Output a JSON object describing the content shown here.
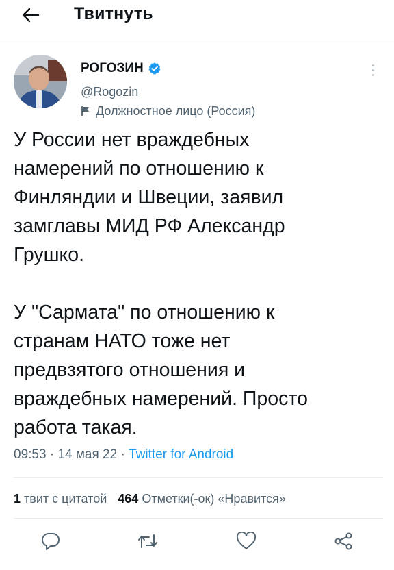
{
  "header": {
    "title": "Твитнуть"
  },
  "author": {
    "name": "РОГОЗИН",
    "handle": "@Rogozin",
    "label": "Должностное лицо (Россия)"
  },
  "tweet": {
    "text": "У России нет враждебных\nнамерений по отношению к\nФинляндии и Швеции, заявил\nзамглавы МИД РФ Александр\nГрушко.\n\nУ \"Сармата\" по отношению к\nстранам НАТО тоже нет\nпредвзятого отношения и\nвраждебных намерений. Просто\nработа такая.",
    "time": "09:53",
    "date": "14 мая 22",
    "sep": "·",
    "source": "Twitter for Android"
  },
  "stats": {
    "quotes_count": "1",
    "quotes_label": "твит с цитатой",
    "likes_count": "464",
    "likes_label": "Отметки(-ок) «Нравится»"
  },
  "colors": {
    "accent": "#1d9bf0",
    "muted": "#536471",
    "text": "#0f1419"
  },
  "icons": [
    "back-arrow-icon",
    "verified-badge-icon",
    "flag-icon",
    "more-vertical-icon",
    "reply-icon",
    "retweet-icon",
    "like-icon",
    "share-icon"
  ]
}
